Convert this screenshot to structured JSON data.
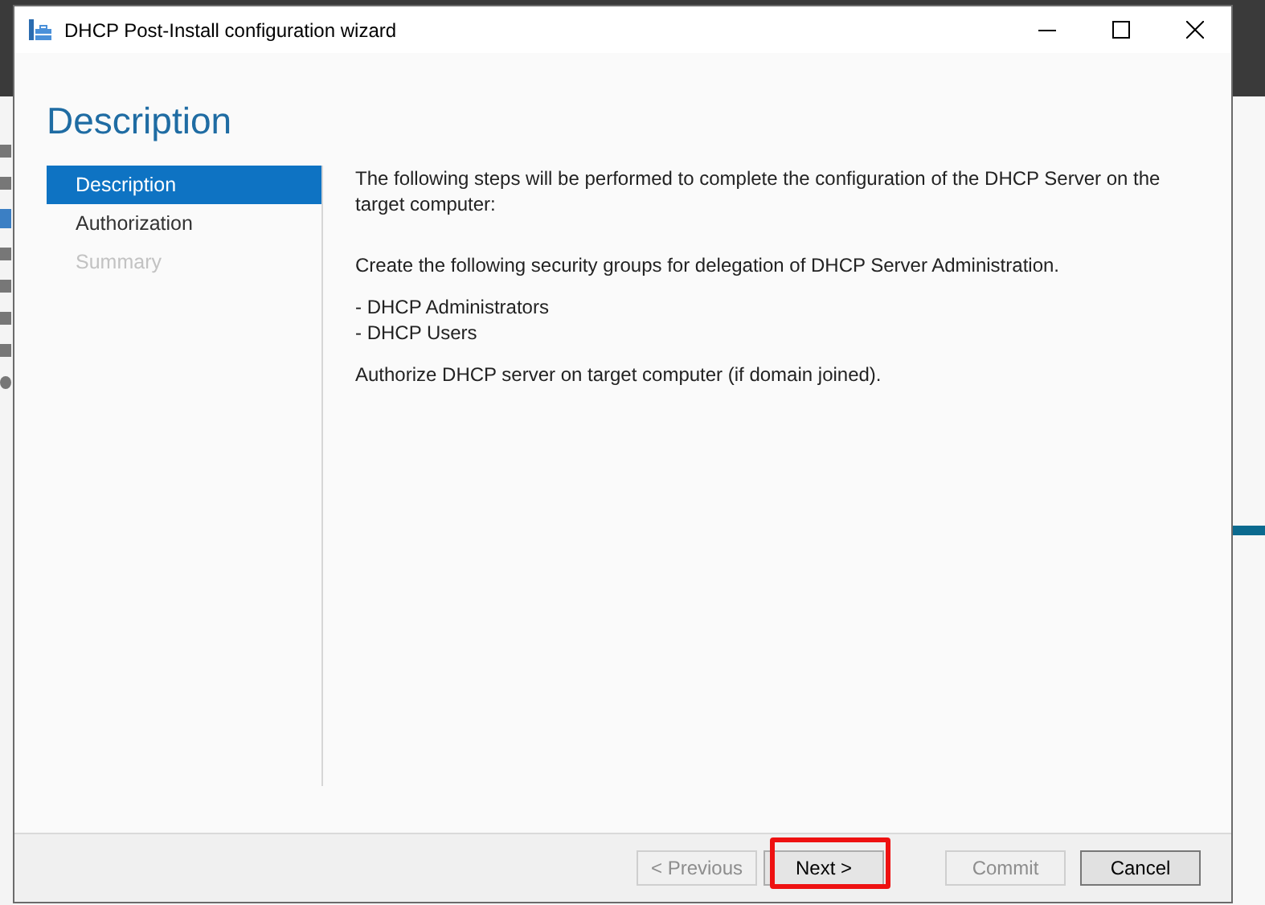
{
  "window": {
    "title": "DHCP Post-Install configuration wizard"
  },
  "page_title": "Description",
  "steps": [
    {
      "label": "Description",
      "selected": true,
      "disabled": false
    },
    {
      "label": "Authorization",
      "selected": false,
      "disabled": false
    },
    {
      "label": "Summary",
      "selected": false,
      "disabled": true
    }
  ],
  "content": [
    {
      "kind": "paragraph",
      "text": "The following steps will be performed to complete the configuration of the DHCP Server on the target computer:"
    },
    {
      "kind": "paragraph",
      "text": "Create the following security groups for delegation of DHCP Server Administration."
    },
    {
      "kind": "list",
      "items": [
        "- DHCP Administrators",
        "- DHCP Users"
      ]
    },
    {
      "kind": "paragraph",
      "text": "Authorize DHCP server on target computer (if domain joined)."
    }
  ],
  "buttons": [
    {
      "label": "< Previous",
      "disabled": true,
      "highlighted": false,
      "default": false
    },
    {
      "label": "Next >",
      "disabled": false,
      "highlighted": true,
      "default": false
    },
    {
      "label": "Commit",
      "disabled": true,
      "highlighted": false,
      "default": false
    },
    {
      "label": "Cancel",
      "disabled": false,
      "highlighted": false,
      "default": true
    }
  ]
}
